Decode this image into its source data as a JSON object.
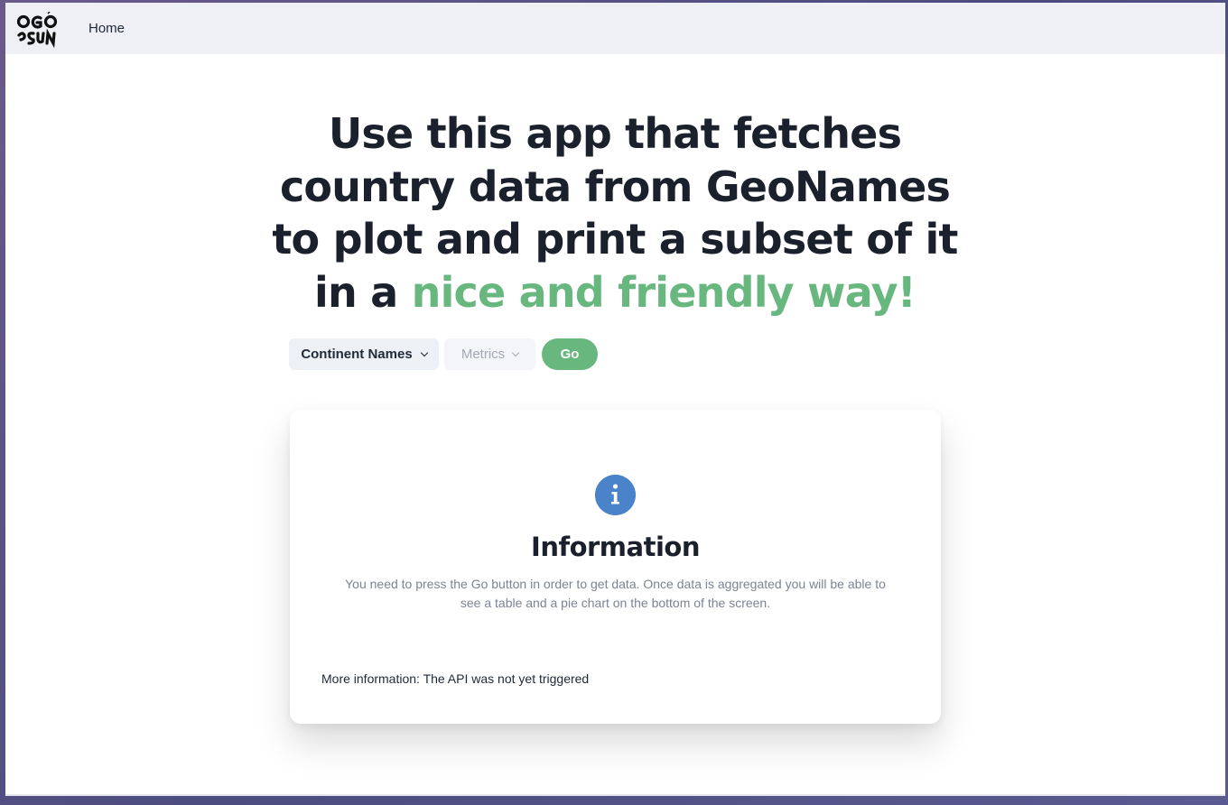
{
  "nav": {
    "logo_alt": "OGO OSUN logo",
    "home_label": "Home"
  },
  "hero": {
    "line1": "Use this app that fetches",
    "line2": "country data from GeoNames",
    "line3": "to plot and print a subset of it",
    "line4_prefix": "in a ",
    "line4_accent": "nice and friendly way!"
  },
  "controls": {
    "continent_label": "Continent Names",
    "metrics_label": "Metrics",
    "go_label": "Go",
    "chevron_icon": "chevron-down-icon"
  },
  "info_card": {
    "icon": "info-icon",
    "title": "Information",
    "text": "You need to press the Go button in order to get data. Once data is aggregated you will be able to see a table and a pie chart on the bottom of the screen.",
    "more": "More information: The API was not yet triggered"
  },
  "colors": {
    "accent_green": "#68b77f",
    "info_blue": "#4a83c9",
    "heading": "#1a202c",
    "navbar_bg": "#eef0f5"
  }
}
